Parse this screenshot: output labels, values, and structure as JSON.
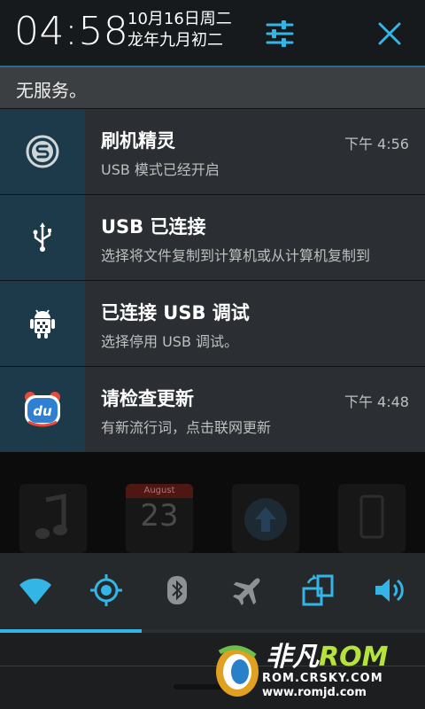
{
  "header": {
    "time": "04:58",
    "date_line1": "10月16日周二",
    "date_line2": "龙年九月初二"
  },
  "carrier": "无服务。",
  "notifications": [
    {
      "title": "刷机精灵",
      "text": "USB 模式已经开启",
      "time": "下午 4:56",
      "icon": "shield-s-icon"
    },
    {
      "title": "USB 已连接",
      "text": "选择将文件复制到计算机或从计算机复制到",
      "time": "",
      "icon": "usb-icon"
    },
    {
      "title": "已连接 USB 调试",
      "text": "选择停用 USB 调试。",
      "time": "",
      "icon": "android-debug-icon"
    },
    {
      "title": "请检查更新",
      "text": "有新流行词，点击联网更新",
      "time": "下午 4:48",
      "icon": "du-keyboard-icon"
    }
  ],
  "home": {
    "calendar_month": "August",
    "calendar_day": "23"
  },
  "toggles": [
    "wifi-icon",
    "gps-icon",
    "bluetooth-icon",
    "airplane-icon",
    "rotate-icon",
    "sound-icon"
  ],
  "watermark": {
    "brand_a": "非凡",
    "brand_b": "ROM",
    "line1": "ROM.CRSKY.COM",
    "line2": "www.romjd.com"
  },
  "colors": {
    "accent": "#33b5e5",
    "icon_bg": "#1d3a4a",
    "panel": "#2b2f33"
  }
}
